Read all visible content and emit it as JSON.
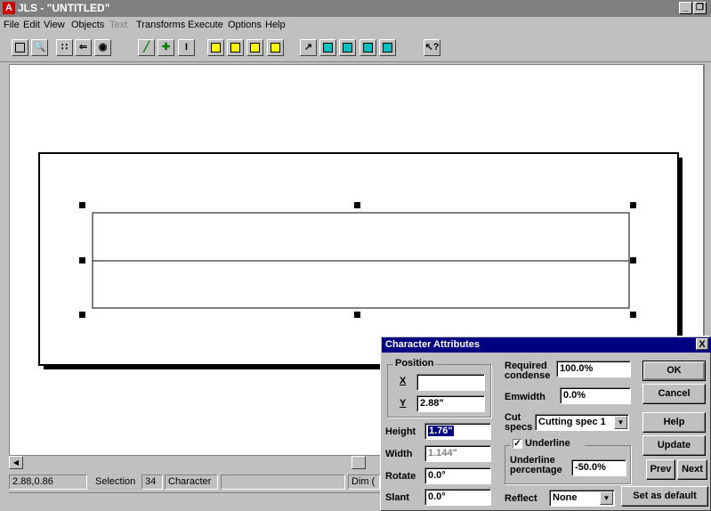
{
  "window": {
    "title": "JLS - \"UNTITLED\"",
    "app_icon": "A",
    "controls": [
      "_",
      "❒"
    ]
  },
  "menubar": {
    "items": [
      {
        "label": "File",
        "disabled": false
      },
      {
        "label": "Edit",
        "disabled": false
      },
      {
        "label": "View",
        "disabled": false
      },
      {
        "label": "Objects",
        "disabled": false
      },
      {
        "label": "Text",
        "disabled": true
      },
      {
        "label": "Transforms",
        "disabled": false
      },
      {
        "label": "Execute",
        "disabled": false
      },
      {
        "label": "Options",
        "disabled": false
      },
      {
        "label": "Help",
        "disabled": false
      }
    ]
  },
  "toolbar": {
    "icons": [
      "select-box-icon",
      "zoom-icon",
      "grid-icon",
      "pan-icon",
      "view-icon",
      "pen-icon",
      "move-icon",
      "text-cursor-icon",
      "yellow-tool-1-icon",
      "yellow-tool-2-icon",
      "yellow-tool-3-icon",
      "yellow-tool-4-icon",
      "arrow-icon",
      "transform-1-icon",
      "transform-2-icon",
      "transform-3-icon",
      "transform-4-icon",
      "help-cursor-icon"
    ]
  },
  "statusbar": {
    "coords": "2.88,0.86",
    "selection_label": "Selection",
    "selection_count": "34",
    "mode": "Character",
    "dim_label": "Dim ("
  },
  "dialog": {
    "title": "Character Attributes",
    "close": "X",
    "position_group": "Position",
    "x_label": "X",
    "x_value": "",
    "y_label": "Y",
    "y_value": "2.88\"",
    "height_label": "Height",
    "height_value": "1.76\"",
    "width_label": "Width",
    "width_value": "1.144\"",
    "rotate_label": "Rotate",
    "rotate_value": "0.0°",
    "slant_label": "Slant",
    "slant_value": "0.0°",
    "required_condense_label_1": "Required",
    "required_condense_label_2": "condense",
    "required_condense_value": "100.0%",
    "emwidth_label": "Emwidth",
    "emwidth_value": "0.0%",
    "cut_label_1": "Cut",
    "cut_label_2": "specs",
    "cut_value": "Cutting spec 1",
    "underline_label": "Underline",
    "underline_checked": true,
    "underline_pct_label_1": "Underline",
    "underline_pct_label_2": "percentage",
    "underline_pct_value": "-50.0%",
    "reflect_label": "Reflect",
    "reflect_value": "None",
    "buttons": {
      "ok": "OK",
      "cancel": "Cancel",
      "help": "Help",
      "update": "Update",
      "prev": "Prev",
      "next": "Next",
      "set_default": "Set as default"
    }
  }
}
